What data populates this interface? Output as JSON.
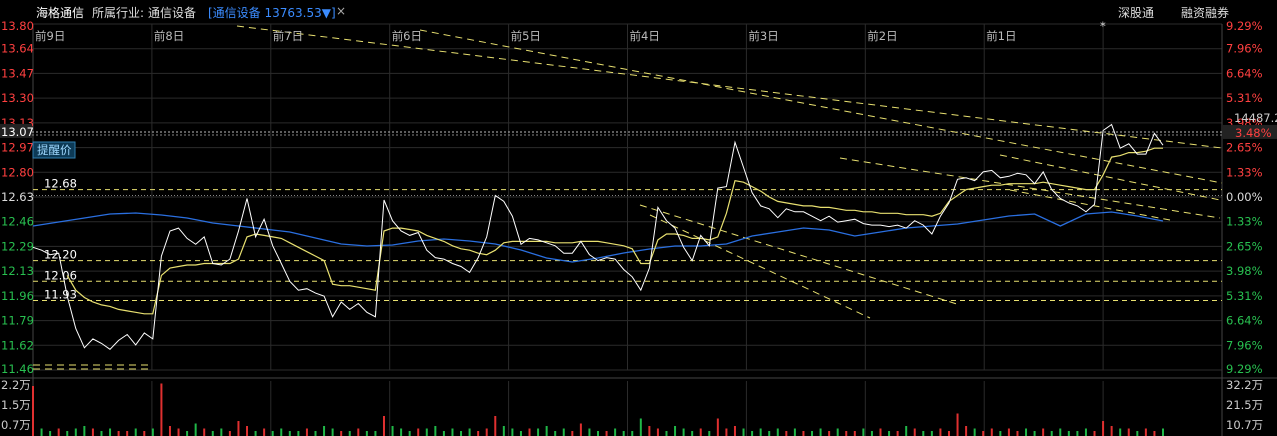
{
  "header": {
    "stock_name": "海格通信",
    "industry_label": "所属行业:",
    "industry_name": "通信设备",
    "index_tag": "[通信设备 13763.53▼]",
    "close_icon": "×",
    "buttons": [
      "深股通",
      "融资融券"
    ]
  },
  "colors": {
    "price_line": "#ffffff",
    "avg_line": "#e8e070",
    "index_line": "#2a6fe0",
    "trend_line": "#e8e070",
    "up_text": "#ff4040",
    "down_text": "#28c050",
    "grid": "#2b2b2b"
  },
  "chart_data": {
    "type": "line",
    "day_labels": [
      "前9日",
      "前8日",
      "前7日",
      "前6日",
      "前5日",
      "前4日",
      "前3日",
      "前2日",
      "前1日"
    ],
    "ylim": [
      11.46,
      13.8
    ],
    "y_ticks": [
      "13.80",
      "13.64",
      "13.47",
      "13.30",
      "13.13",
      "12.97",
      "12.80",
      "12.63",
      "12.46",
      "12.29",
      "12.13",
      "11.96",
      "11.79",
      "11.62",
      "11.46"
    ],
    "pct_ticks": [
      "9.29%",
      "7.96%",
      "6.64%",
      "5.31%",
      "3.98%",
      "2.65%",
      "1.33%",
      "0.00%",
      "1.33%",
      "2.65%",
      "3.98%",
      "5.31%",
      "6.64%",
      "7.96%",
      "9.29%"
    ],
    "price_line_label": "13.07",
    "price_line_pct": "3.48%",
    "index_readout": "14487.2",
    "remind_label": "提醒价",
    "alert_prices": [
      "12.68",
      "12.20",
      "12.06",
      "11.93"
    ],
    "alert_values": [
      12.68,
      12.2,
      12.06,
      11.93
    ],
    "reference_price": 12.64,
    "star_icon": "*",
    "price": [
      12.29,
      12.27,
      12.24,
      12.25,
      11.96,
      11.74,
      11.61,
      11.67,
      11.64,
      11.6,
      11.66,
      11.7,
      11.63,
      11.71,
      11.67,
      12.23,
      12.4,
      12.42,
      12.35,
      12.31,
      12.36,
      12.18,
      12.17,
      12.21,
      12.4,
      12.62,
      12.36,
      12.48,
      12.3,
      12.18,
      12.06,
      12.0,
      12.01,
      11.98,
      11.96,
      11.82,
      11.92,
      11.87,
      11.91,
      11.85,
      11.82,
      12.61,
      12.47,
      12.4,
      12.37,
      12.39,
      12.27,
      12.22,
      12.21,
      12.18,
      12.16,
      12.12,
      12.22,
      12.36,
      12.64,
      12.6,
      12.5,
      12.31,
      12.35,
      12.34,
      12.32,
      12.3,
      12.25,
      12.25,
      12.33,
      12.24,
      12.2,
      12.22,
      12.21,
      12.14,
      12.09,
      12.0,
      12.15,
      12.56,
      12.47,
      12.42,
      12.29,
      12.2,
      12.37,
      12.3,
      12.69,
      12.7,
      13.0,
      12.83,
      12.66,
      12.57,
      12.55,
      12.49,
      12.55,
      12.53,
      12.53,
      12.5,
      12.47,
      12.5,
      12.46,
      12.47,
      12.48,
      12.45,
      12.44,
      12.44,
      12.43,
      12.44,
      12.42,
      12.47,
      12.44,
      12.38,
      12.5,
      12.59,
      12.75,
      12.76,
      12.74,
      12.8,
      12.81,
      12.76,
      12.77,
      12.79,
      12.78,
      12.72,
      12.8,
      12.68,
      12.62,
      12.59,
      12.57,
      12.53,
      12.58,
      13.08,
      13.12,
      12.96,
      12.99,
      12.92,
      12.92,
      13.06,
      12.98
    ],
    "avg": [
      null,
      null,
      null,
      null,
      12.1,
      12.0,
      11.95,
      11.92,
      11.9,
      11.89,
      11.87,
      11.86,
      11.85,
      11.84,
      11.84,
      12.1,
      12.15,
      12.16,
      12.17,
      12.17,
      12.18,
      12.18,
      12.18,
      12.18,
      12.21,
      12.36,
      12.38,
      12.37,
      12.36,
      12.35,
      12.32,
      12.29,
      12.26,
      12.23,
      12.2,
      12.04,
      12.03,
      12.03,
      12.02,
      12.01,
      12.0,
      12.4,
      12.42,
      12.42,
      12.41,
      12.4,
      12.37,
      12.35,
      12.33,
      12.3,
      12.28,
      12.27,
      12.25,
      12.24,
      12.27,
      12.32,
      12.33,
      12.33,
      12.33,
      12.33,
      12.33,
      12.32,
      12.32,
      12.32,
      12.33,
      12.33,
      12.33,
      12.32,
      12.31,
      12.3,
      12.28,
      12.18,
      12.18,
      12.34,
      12.38,
      12.38,
      12.37,
      12.35,
      12.35,
      12.34,
      12.36,
      12.52,
      12.74,
      12.73,
      12.7,
      12.67,
      12.63,
      12.6,
      12.59,
      12.58,
      12.57,
      12.57,
      12.56,
      12.56,
      12.55,
      12.54,
      12.54,
      12.53,
      12.53,
      12.52,
      12.52,
      12.52,
      12.51,
      12.51,
      12.51,
      12.5,
      12.52,
      12.6,
      12.64,
      12.68,
      12.69,
      12.7,
      12.71,
      12.71,
      12.72,
      12.72,
      12.72,
      12.72,
      12.73,
      12.72,
      12.71,
      12.7,
      12.69,
      12.68,
      12.68,
      12.78,
      12.9,
      12.91,
      12.93,
      12.93,
      12.94,
      12.96,
      12.96
    ],
    "volume_ticks": [
      "2.2万",
      "1.5万",
      "0.7万"
    ],
    "volume_ticks_right": [
      "32.2万",
      "21.5万",
      "10.7万"
    ],
    "vol_max": 2.2,
    "volumes": [
      2.0,
      0.3,
      0.2,
      0.3,
      0.2,
      0.3,
      0.4,
      0.3,
      0.2,
      0.3,
      0.2,
      0.2,
      0.3,
      0.2,
      0.3,
      2.1,
      0.4,
      0.3,
      0.2,
      0.5,
      0.3,
      0.2,
      0.3,
      0.2,
      0.6,
      0.4,
      0.2,
      0.3,
      0.2,
      0.3,
      0.2,
      0.2,
      0.3,
      0.2,
      0.4,
      0.3,
      0.2,
      0.2,
      0.3,
      0.2,
      0.2,
      0.8,
      0.4,
      0.3,
      0.2,
      0.3,
      0.3,
      0.4,
      0.2,
      0.3,
      0.2,
      0.3,
      0.2,
      0.3,
      0.8,
      0.4,
      0.3,
      0.2,
      0.3,
      0.3,
      0.4,
      0.2,
      0.3,
      0.2,
      0.5,
      0.3,
      0.2,
      0.2,
      0.3,
      0.2,
      0.2,
      0.7,
      0.4,
      0.3,
      0.2,
      0.4,
      0.3,
      0.2,
      0.3,
      0.2,
      0.7,
      0.3,
      0.4,
      0.3,
      0.2,
      0.3,
      0.2,
      0.3,
      0.2,
      0.3,
      0.2,
      0.2,
      0.3,
      0.2,
      0.3,
      0.2,
      0.2,
      0.3,
      0.2,
      0.3,
      0.2,
      0.2,
      0.4,
      0.3,
      0.2,
      0.2,
      0.3,
      0.2,
      0.9,
      0.4,
      0.3,
      0.2,
      0.3,
      0.2,
      0.3,
      0.2,
      0.3,
      0.2,
      0.3,
      0.2,
      0.3,
      0.2,
      0.2,
      0.3,
      0.2,
      0.6,
      0.4,
      0.3,
      0.3,
      0.2,
      0.3,
      0.2,
      0.3
    ]
  }
}
